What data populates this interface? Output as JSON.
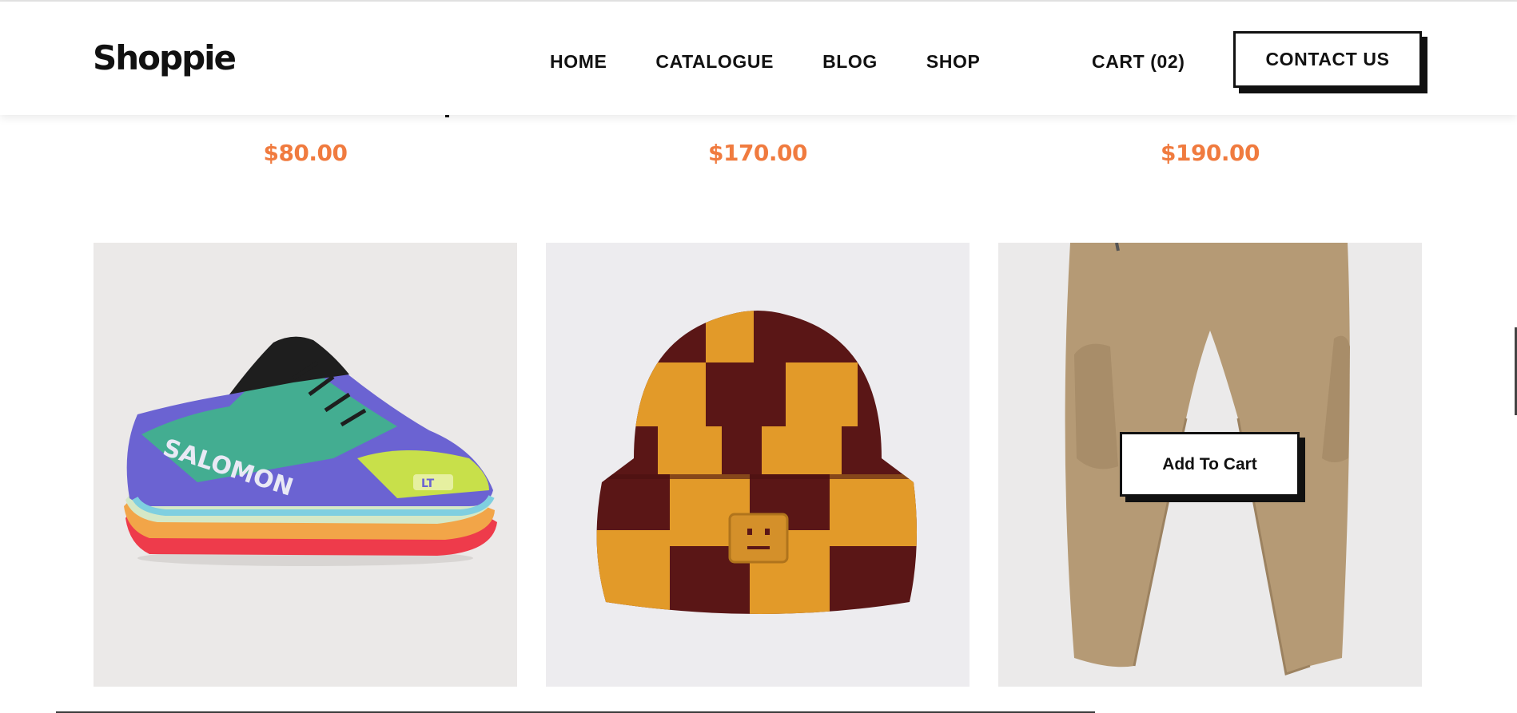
{
  "header": {
    "logo": "Shoppie",
    "nav": [
      "HOME",
      "CATALOGUE",
      "BLOG",
      "SHOP"
    ],
    "cart": "CART (02)",
    "contact": "CONTACT US"
  },
  "prices": [
    "$80.00",
    "$170.00",
    "$190.00"
  ],
  "products": [
    {
      "image": "sneaker-image",
      "brand_print": "SALOMON",
      "badge_print": "LT"
    },
    {
      "image": "beanie-image"
    },
    {
      "image": "pants-image",
      "action": "Add To Cart"
    }
  ],
  "colors": {
    "accent": "#f07b3f",
    "text": "#111111",
    "card_bg_1": "#ebe9e8",
    "card_bg_2": "#edecef",
    "card_bg_3": "#ebeaea"
  }
}
